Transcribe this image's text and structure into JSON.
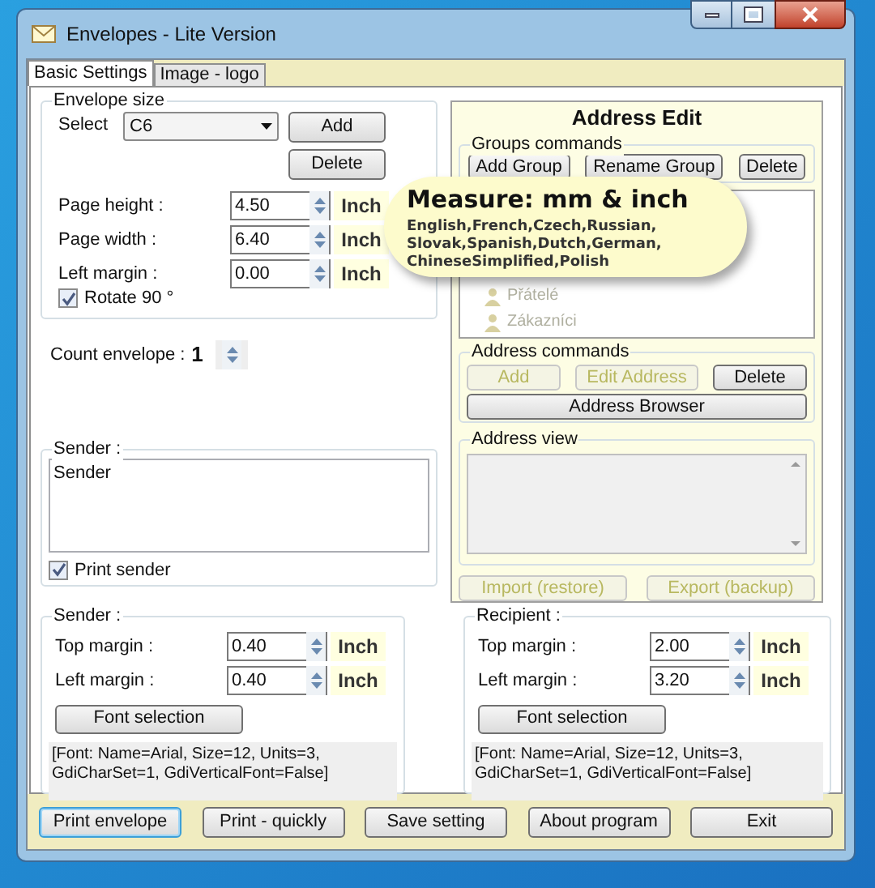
{
  "window": {
    "title": "Envelopes - Lite Version"
  },
  "tabs": [
    {
      "label": "Basic Settings",
      "selected": true
    },
    {
      "label": "Image - logo",
      "selected": false
    }
  ],
  "envelope_size": {
    "title": "Envelope size",
    "select_label": "Select",
    "select_value": "C6",
    "buttons": [
      "Add",
      "Delete"
    ],
    "fields": [
      {
        "label": "Page height :",
        "value": "4.50",
        "unit": "Inch"
      },
      {
        "label": "Page width :",
        "value": "6.40",
        "unit": "Inch"
      },
      {
        "label": "Left margin  :",
        "value": "0.00",
        "unit": "Inch"
      }
    ],
    "rotate": {
      "label": "Rotate 90 °",
      "checked": true
    }
  },
  "count": {
    "label": "Count envelope :",
    "value": "1"
  },
  "sender_text": {
    "title": "Sender :",
    "value": "Sender",
    "print": {
      "label": "Print sender",
      "checked": true
    }
  },
  "address_edit": {
    "title": "Address Edit",
    "groups_commands": {
      "title": "Groups commands",
      "buttons": [
        {
          "label": "Add Group",
          "disabled": false
        },
        {
          "label": "Rename Group",
          "disabled": false
        },
        {
          "label": "Delete",
          "disabled": false
        }
      ]
    },
    "groups": [
      "Přátelé",
      "Zákazníci"
    ],
    "address_commands": {
      "title": "Address commands",
      "buttons": [
        {
          "label": "Add",
          "disabled": true
        },
        {
          "label": "Edit Address",
          "disabled": true
        },
        {
          "label": "Delete",
          "disabled": false
        }
      ],
      "browser": "Address Browser"
    },
    "address_view": {
      "title": "Address view"
    },
    "bottom_buttons": [
      {
        "label": "Import (restore)",
        "disabled": true
      },
      {
        "label": "Export (backup)",
        "disabled": true
      }
    ]
  },
  "callout": {
    "title": "Measure: mm & inch",
    "text": "English,French,Czech,Russian, Slovak,Spanish,Dutch,German, ChineseSimplified,Polish"
  },
  "margins": [
    {
      "title": "Sender :",
      "fields": [
        {
          "label": "Top margin  :",
          "value": "0.40",
          "unit": "Inch"
        },
        {
          "label": "Left margin :",
          "value": "0.40",
          "unit": "Inch"
        }
      ],
      "font_button": "Font selection",
      "font_info": "[Font: Name=Arial, Size=12, Units=3, GdiCharSet=1, GdiVerticalFont=False]"
    },
    {
      "title": "Recipient :",
      "fields": [
        {
          "label": "Top margin  :",
          "value": "2.00",
          "unit": "Inch"
        },
        {
          "label": "Left margin  :",
          "value": "3.20",
          "unit": "Inch"
        }
      ],
      "font_button": "Font selection",
      "font_info": "[Font: Name=Arial, Size=12, Units=3, GdiCharSet=1, GdiVerticalFont=False]"
    }
  ],
  "footer_buttons": [
    {
      "label": "Print envelope",
      "selected": true
    },
    {
      "label": "Print - quickly",
      "selected": false
    },
    {
      "label": "Save setting",
      "selected": false
    },
    {
      "label": "About program",
      "selected": false
    },
    {
      "label": "Exit",
      "selected": false
    }
  ]
}
